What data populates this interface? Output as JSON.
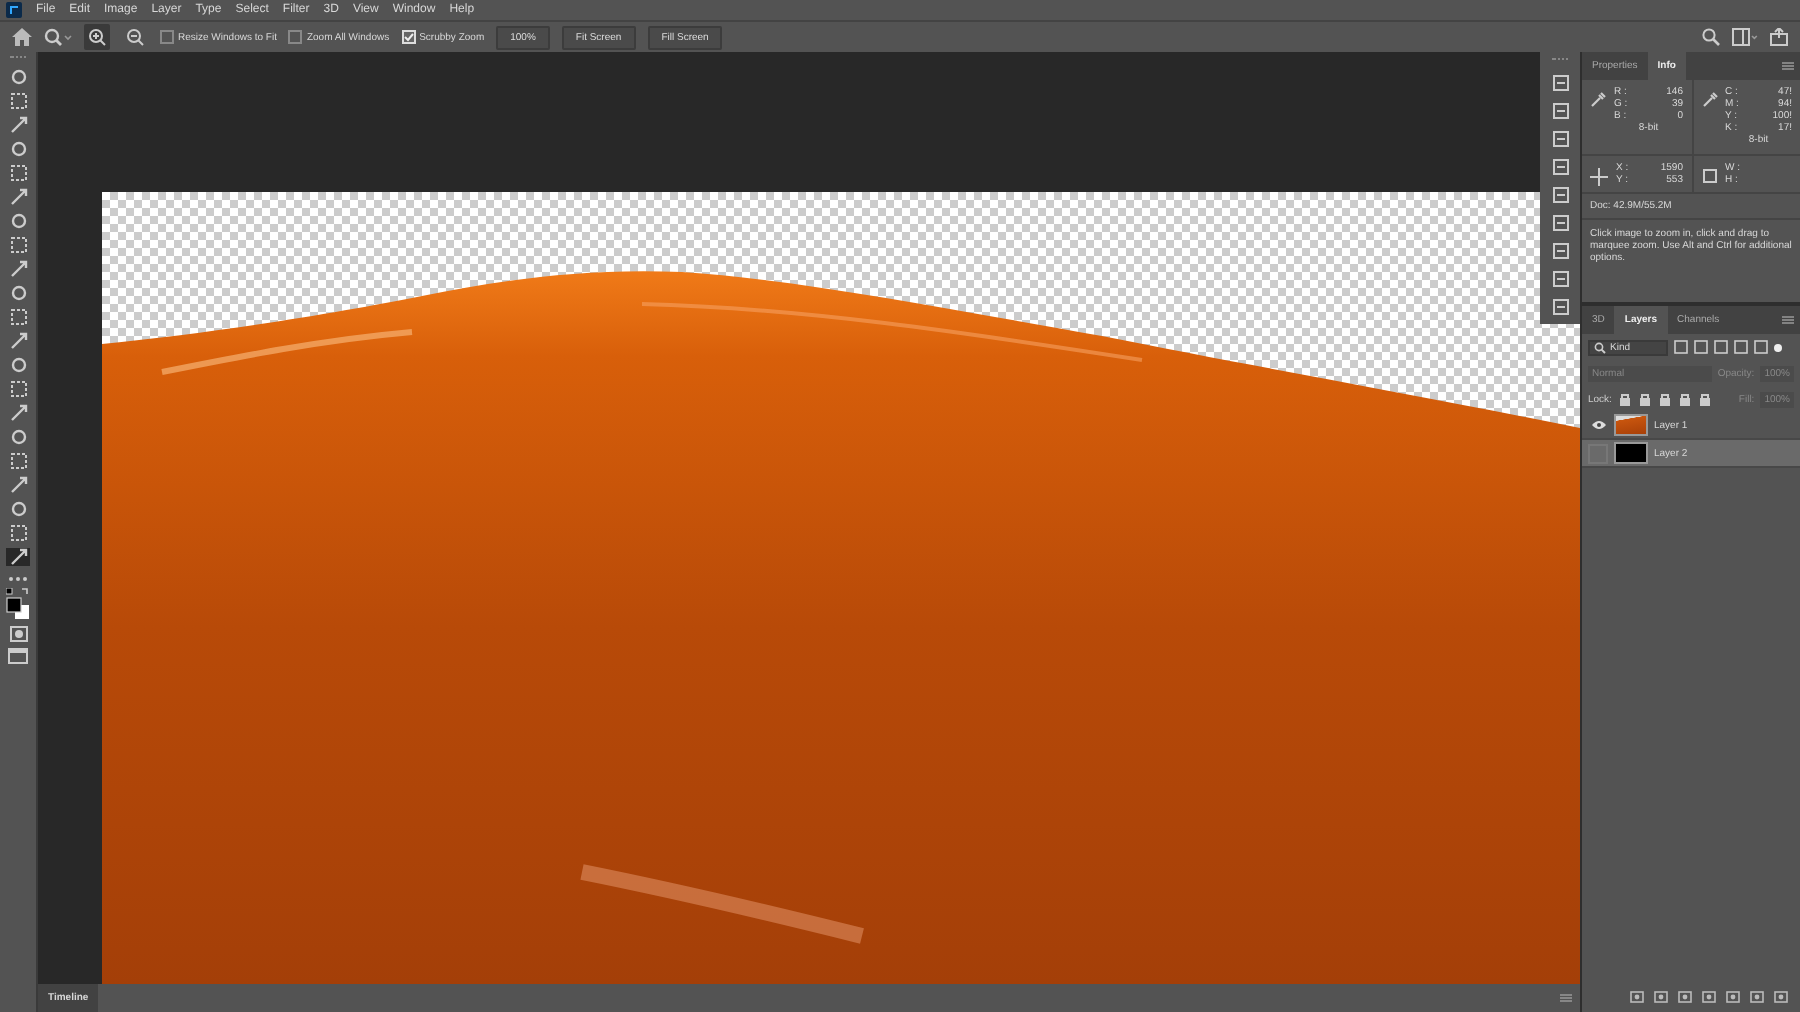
{
  "menu": [
    "File",
    "Edit",
    "Image",
    "Layer",
    "Type",
    "Select",
    "Filter",
    "3D",
    "View",
    "Window",
    "Help"
  ],
  "options": {
    "checks": [
      {
        "label": "Resize Windows to Fit",
        "checked": false
      },
      {
        "label": "Zoom All Windows",
        "checked": false
      },
      {
        "label": "Scrubby Zoom",
        "checked": true
      }
    ],
    "buttons": [
      "100%",
      "Fit Screen",
      "Fill Screen"
    ]
  },
  "tools": [
    {
      "selected": false
    },
    {
      "selected": false
    },
    {
      "selected": false
    },
    {
      "selected": false
    },
    {
      "selected": false
    },
    {
      "selected": false
    },
    {
      "selected": false
    },
    {
      "selected": false
    },
    {
      "selected": false
    },
    {
      "selected": false
    },
    {
      "selected": false
    },
    {
      "selected": false
    },
    {
      "selected": false
    },
    {
      "selected": false
    },
    {
      "selected": false
    },
    {
      "selected": false
    },
    {
      "selected": false
    },
    {
      "selected": false
    },
    {
      "selected": false
    },
    {
      "selected": false
    },
    {
      "selected": true
    }
  ],
  "info_panel": {
    "tabs": [
      {
        "label": "Properties",
        "selected": false
      },
      {
        "label": "Info",
        "selected": true
      }
    ],
    "rgb": [
      {
        "label": "R :",
        "value": "146"
      },
      {
        "label": "G :",
        "value": "39"
      },
      {
        "label": "B :",
        "value": "0"
      }
    ],
    "rgb_bits": "8-bit",
    "cmyk": [
      {
        "label": "C :",
        "value": "47!"
      },
      {
        "label": "M :",
        "value": "94!"
      },
      {
        "label": "Y :",
        "value": "100!"
      },
      {
        "label": "K :",
        "value": "17!"
      }
    ],
    "cmyk_bits": "8-bit",
    "position": [
      {
        "label": "X :",
        "value": "1590"
      },
      {
        "label": "Y :",
        "value": "553"
      }
    ],
    "size": [
      {
        "label": "W :"
      },
      {
        "label": "H :"
      }
    ],
    "doc": "Doc: 42.9M/55.2M",
    "hint": "Click image to zoom in, click and drag to marquee zoom.  Use Alt and Ctrl for additional options."
  },
  "layers_panel": {
    "tabs": [
      {
        "label": "3D",
        "selected": false
      },
      {
        "label": "Layers",
        "selected": true
      },
      {
        "label": "Channels",
        "selected": false
      }
    ],
    "filter": "Kind",
    "blend_mode": "Normal",
    "opacity_label": "Opacity:",
    "opacity": "100%",
    "lock_label": "Lock:",
    "fill_label": "Fill:",
    "fill": "100%",
    "layers": [
      {
        "name": "Layer 1",
        "visible": true,
        "selected": false,
        "kind": "image"
      },
      {
        "name": "Layer 2",
        "visible": false,
        "selected": true,
        "kind": "black"
      }
    ]
  },
  "timeline": {
    "title": "Timeline"
  }
}
